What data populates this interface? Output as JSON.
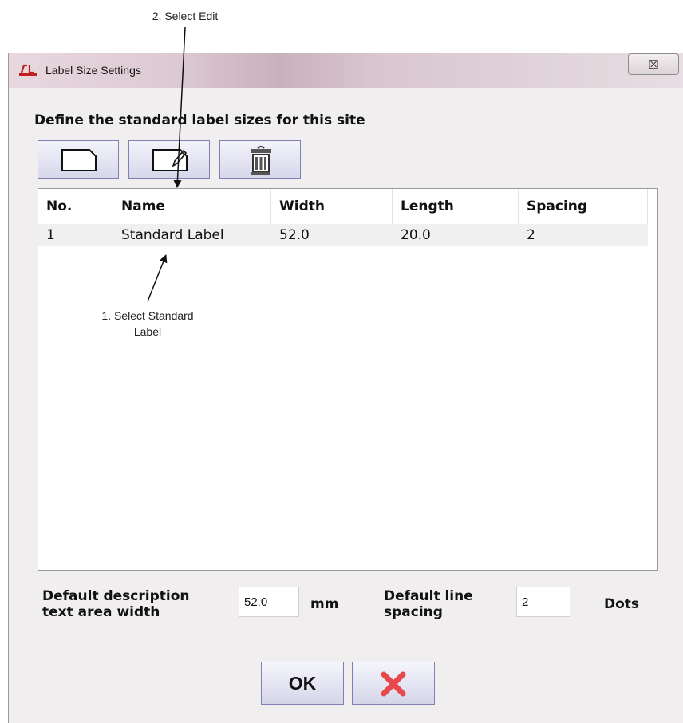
{
  "callouts": {
    "select_edit": "2. Select Edit",
    "select_label_line1": "1. Select Standard",
    "select_label_line2": "Label"
  },
  "window": {
    "title": "Label Size Settings",
    "close_glyph": "☒",
    "app_icon": "app-logo-icon",
    "titlebar_color": "#dccad2",
    "background": "#f0eeee"
  },
  "heading": "Define the standard label sizes for this site",
  "toolbar": {
    "new_icon": "new-page-icon",
    "edit_icon": "edit-pencil-icon",
    "delete_icon": "trash-bin-icon",
    "button_color": "#d7d7ec"
  },
  "table": {
    "columns": [
      "No.",
      "Name",
      "Width",
      "Length",
      "Spacing"
    ],
    "rows": [
      [
        "1",
        "Standard Label",
        "52.0",
        "20.0",
        "2"
      ]
    ],
    "selected_row_color": "#f0f0f0"
  },
  "settings": {
    "width_label_line1": "Default description",
    "width_label_line2": "text area width",
    "width_value": "52.0",
    "width_unit": "mm",
    "spacing_label_line1": "Default line",
    "spacing_label_line2": "spacing",
    "spacing_value": "2",
    "spacing_unit": "Dots"
  },
  "buttons": {
    "ok_label": "OK",
    "cancel_icon": "red-x-icon",
    "cancel_color": "#e8474b"
  }
}
